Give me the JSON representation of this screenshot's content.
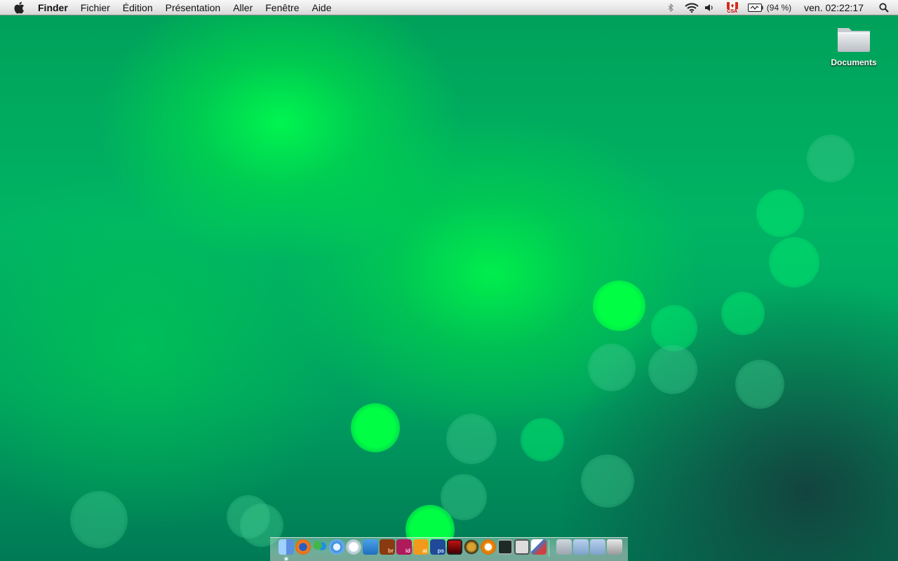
{
  "menubar": {
    "app_name": "Finder",
    "menus": [
      "Fichier",
      "Édition",
      "Présentation",
      "Aller",
      "Fenêtre",
      "Aide"
    ],
    "status": {
      "input_source_flag_text": "CSA",
      "battery_text": "(94 %)",
      "clock": "ven. 02:22:17"
    }
  },
  "desktop": {
    "icons": [
      {
        "label": "Documents",
        "icon": "folder-icon"
      }
    ]
  },
  "dock": {
    "items": [
      {
        "name": "finder",
        "label": ""
      },
      {
        "name": "firefox",
        "label": ""
      },
      {
        "name": "messenger",
        "label": ""
      },
      {
        "name": "itunes",
        "label": ""
      },
      {
        "name": "safari",
        "label": ""
      },
      {
        "name": "wunderlist",
        "label": ""
      },
      {
        "name": "bridge",
        "label": "br"
      },
      {
        "name": "indesign",
        "label": "id"
      },
      {
        "name": "illustrator",
        "label": "ai"
      },
      {
        "name": "photoshop",
        "label": "ps"
      },
      {
        "name": "photo-booth",
        "label": ""
      },
      {
        "name": "grapher",
        "label": ""
      },
      {
        "name": "half-life",
        "label": ""
      },
      {
        "name": "activity-monitor",
        "label": ""
      },
      {
        "name": "system-profiler",
        "label": ""
      },
      {
        "name": "preview",
        "label": ""
      },
      {
        "name": "applications-folder",
        "label": ""
      },
      {
        "name": "documents-stack",
        "label": ""
      },
      {
        "name": "downloads-stack",
        "label": ""
      },
      {
        "name": "trash",
        "label": ""
      }
    ]
  }
}
